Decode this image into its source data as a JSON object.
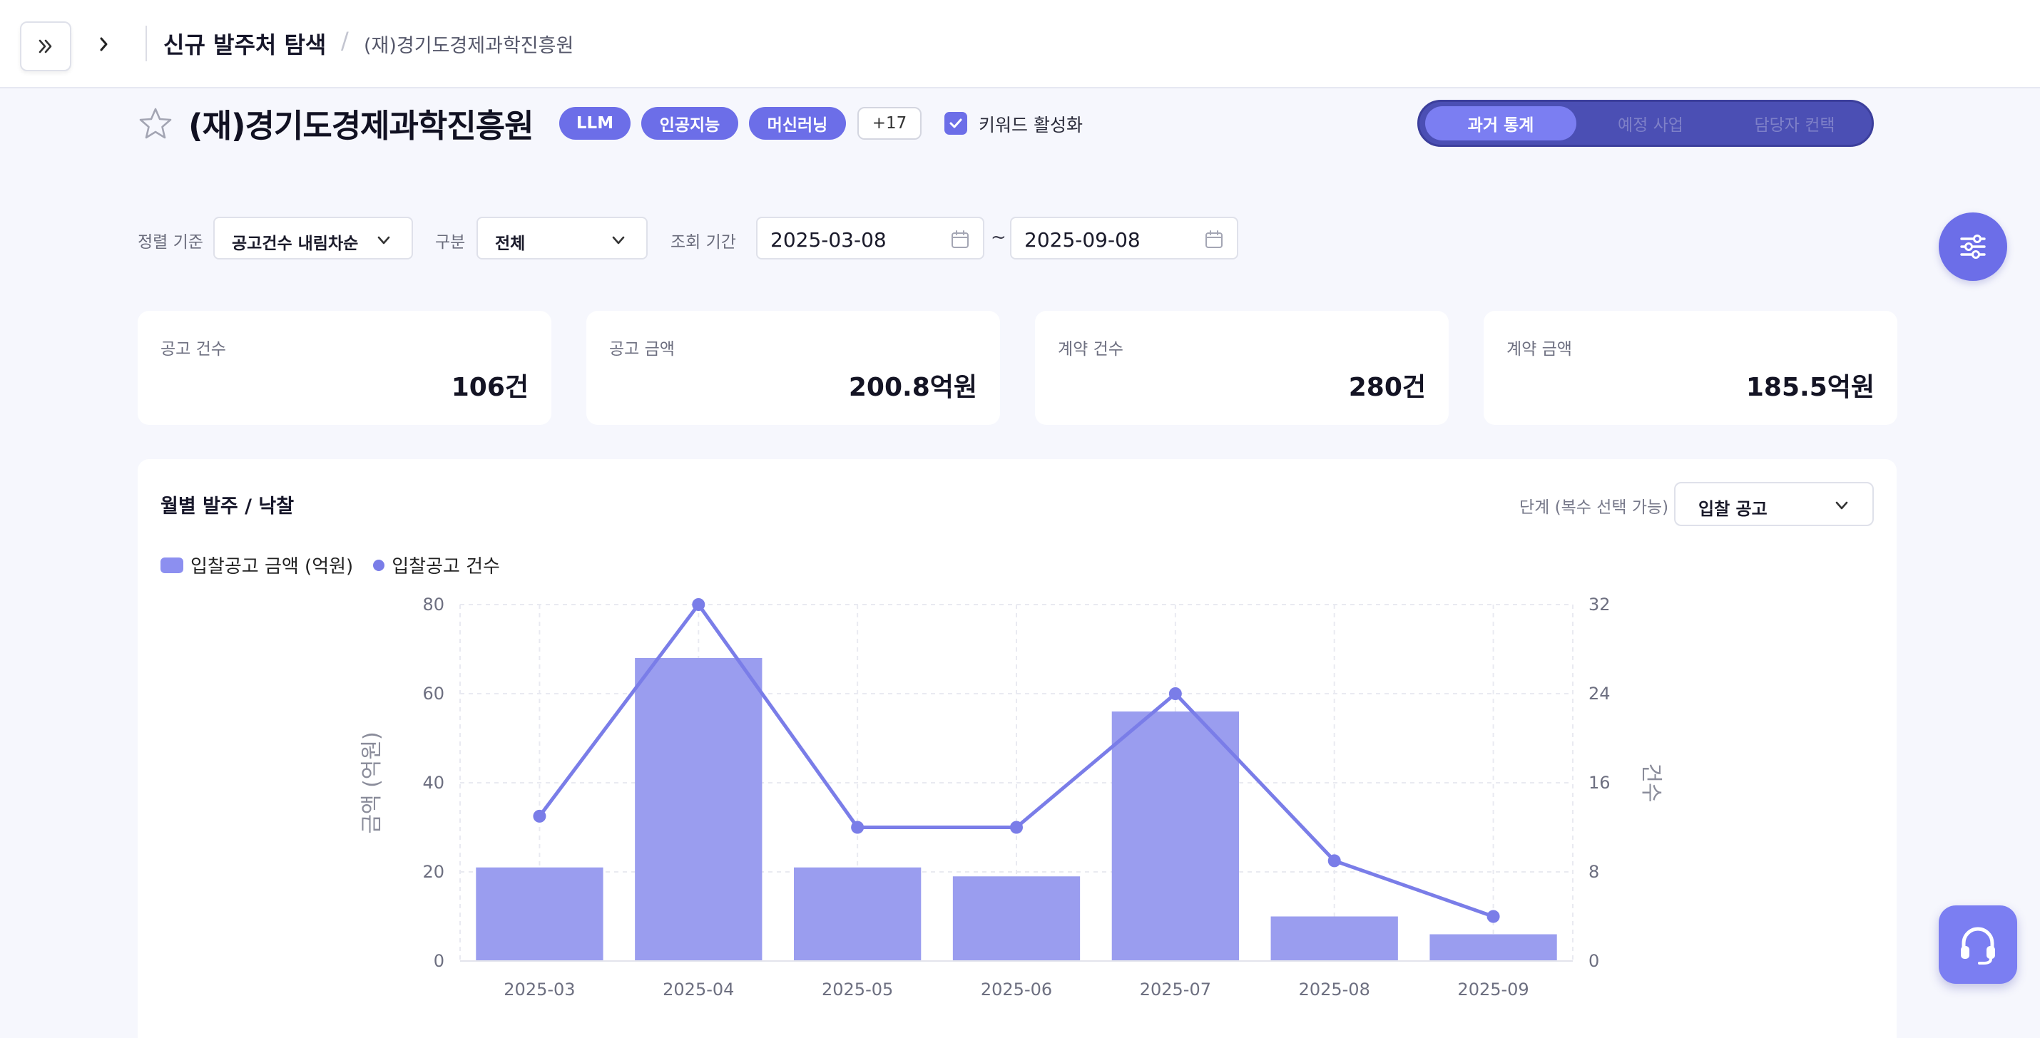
{
  "header": {
    "breadcrumb_main": "신규 발주처 탐색",
    "breadcrumb_sep": "/",
    "breadcrumb_sub": "(재)경기도경제과학진흥원"
  },
  "title_row": {
    "org_name": "(재)경기도경제과학진흥원",
    "chips": [
      "LLM",
      "인공지능",
      "머신러닝"
    ],
    "more_chip": "+17",
    "keyword_label": "키워드 활성화"
  },
  "tabs": [
    "과거 통계",
    "예정 사업",
    "담당자 컨택"
  ],
  "filters": {
    "sort_label": "정렬 기준",
    "sort_value": "공고건수 내림차순",
    "type_label": "구분",
    "type_value": "전체",
    "period_label": "조회 기간",
    "date_from": "2025-03-08",
    "tilde": "~",
    "date_to": "2025-09-08"
  },
  "stats": [
    {
      "label": "공고 건수",
      "value": "106건"
    },
    {
      "label": "공고 금액",
      "value": "200.8억원"
    },
    {
      "label": "계약 건수",
      "value": "280건"
    },
    {
      "label": "계약 금액",
      "value": "185.5억원"
    }
  ],
  "panel": {
    "title": "월별 발주 / 낙찰",
    "stage_label": "단계 (복수 선택 가능)",
    "stage_value": "입찰 공고"
  },
  "colors": {
    "accent": "#6c6ee8",
    "bar": "#9a9def",
    "line": "#7a7de8"
  },
  "chart_data": {
    "type": "bar",
    "categories": [
      "2025-03",
      "2025-04",
      "2025-05",
      "2025-06",
      "2025-07",
      "2025-08",
      "2025-09"
    ],
    "series": [
      {
        "name": "입찰공고 금액 (억원)",
        "type": "bar",
        "axis": "left",
        "values": [
          21,
          68,
          21,
          19,
          56,
          10,
          6
        ]
      },
      {
        "name": "입찰공고 건수",
        "type": "line",
        "axis": "right",
        "values": [
          13,
          32,
          12,
          12,
          24,
          9,
          4
        ]
      }
    ],
    "ylabel": "금액 (억원)",
    "y2label": "건수",
    "ylim": [
      0,
      80
    ],
    "y2lim": [
      0,
      32
    ],
    "yticks": [
      0,
      20,
      40,
      60,
      80
    ],
    "y2ticks": [
      0,
      8,
      16,
      24,
      32
    ],
    "grid": true,
    "legend": "top-left"
  }
}
